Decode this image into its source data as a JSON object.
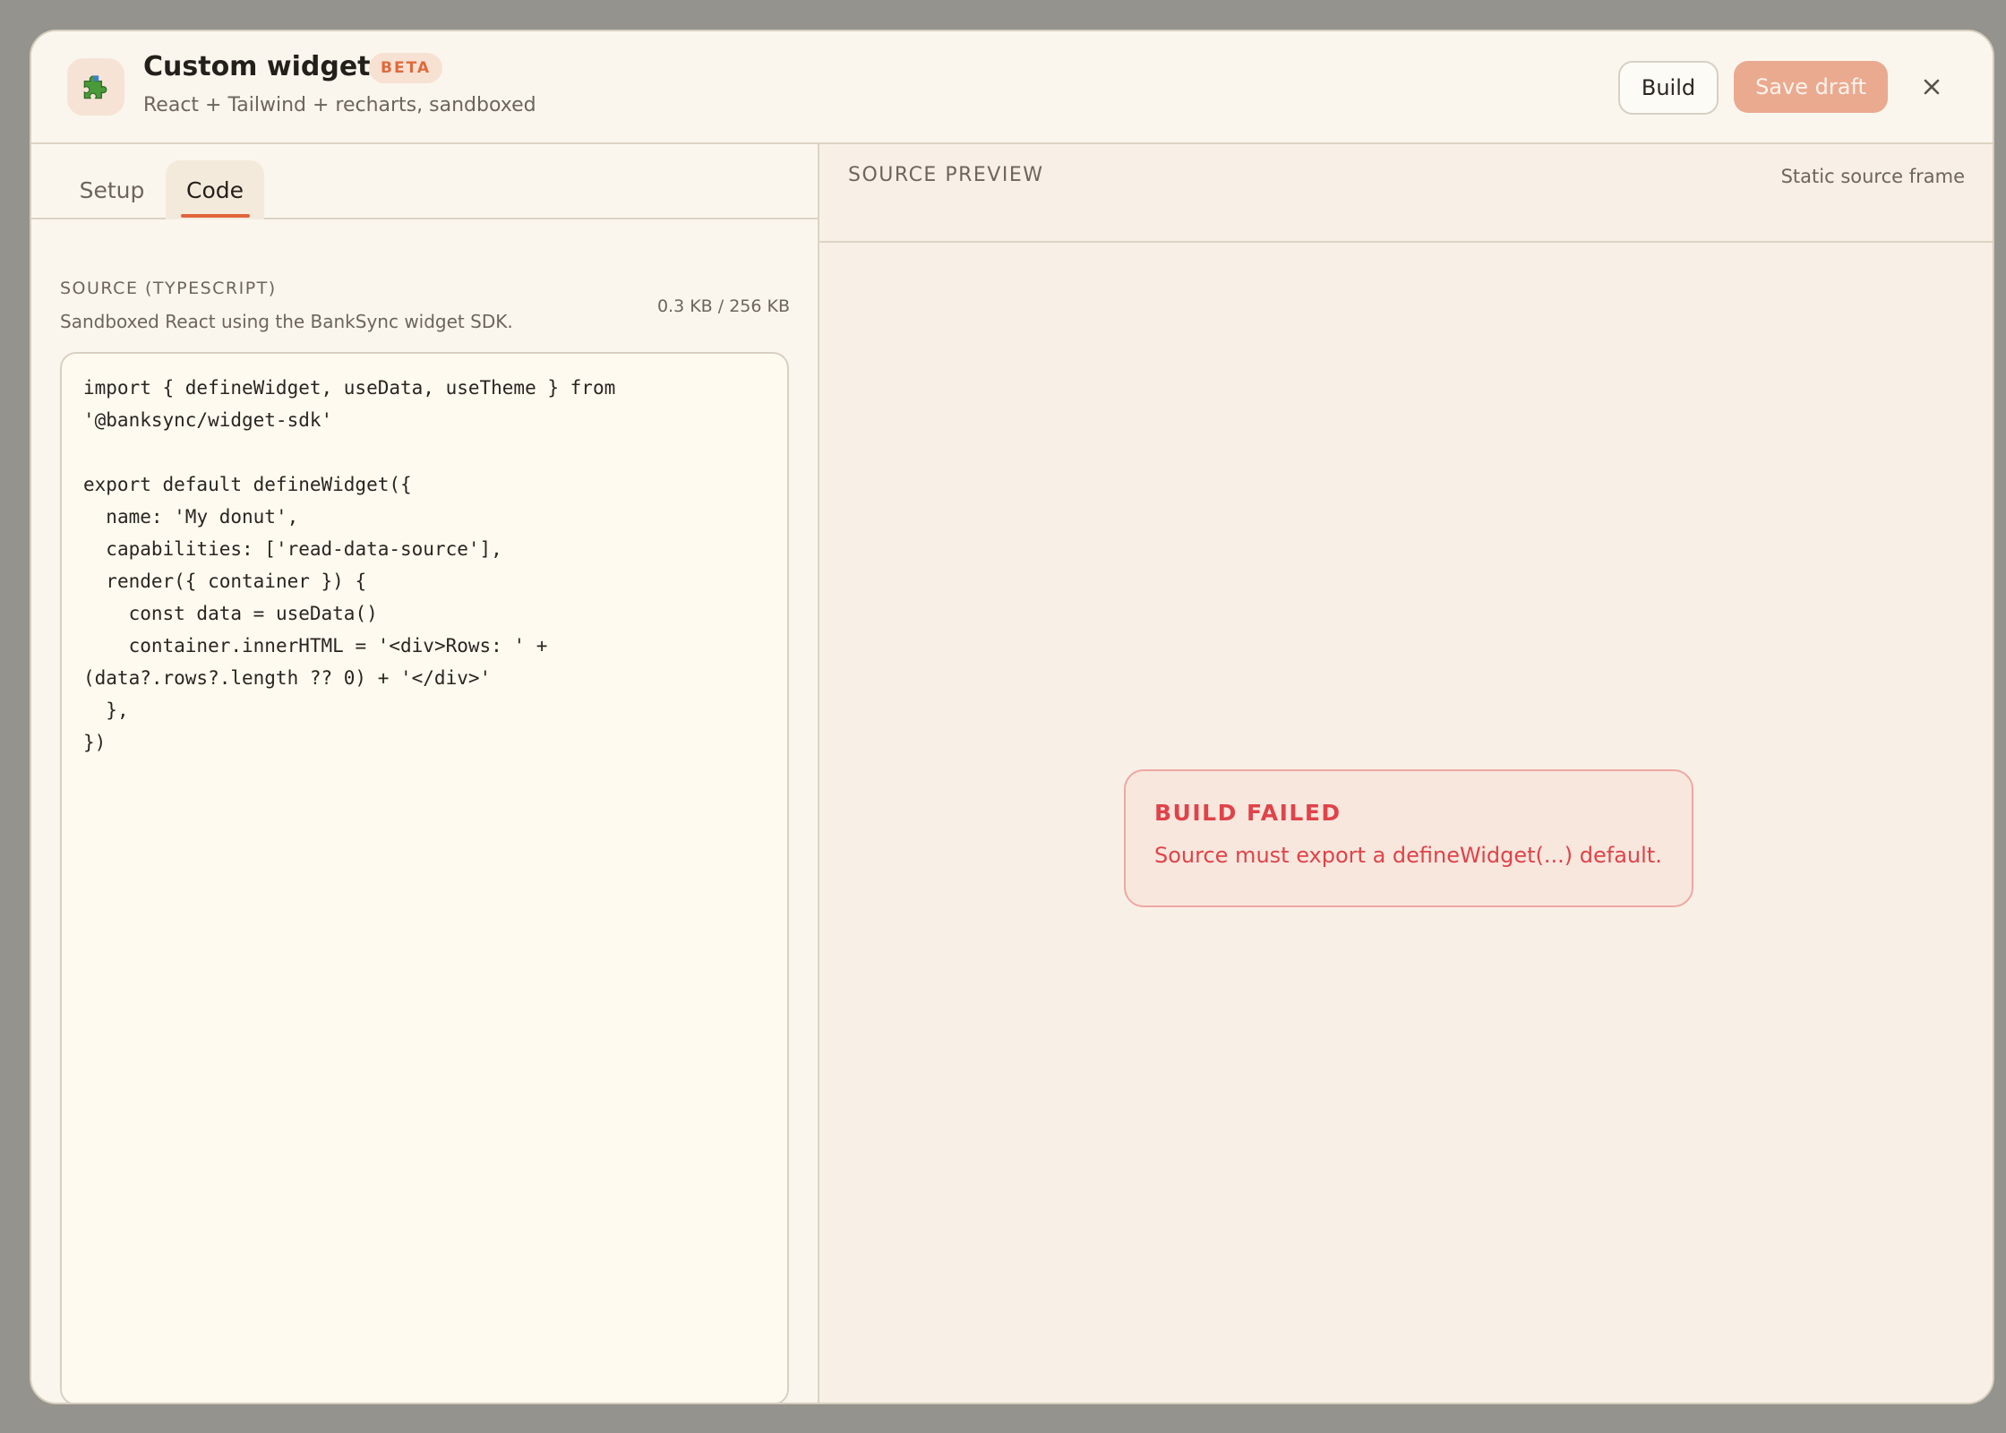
{
  "header": {
    "app_icon": "puzzle-piece-icon",
    "title": "Custom widget",
    "badge": "BETA",
    "subtitle": "React + Tailwind + recharts, sandboxed",
    "build_label": "Build",
    "save_label": "Save draft",
    "close_icon": "close-icon"
  },
  "tabs": [
    {
      "label": "Setup",
      "active": false
    },
    {
      "label": "Code",
      "active": true
    }
  ],
  "source": {
    "label": "SOURCE (TYPESCRIPT)",
    "description": "Sandboxed React using the BankSync widget SDK.",
    "size": "0.3 KB / 256 KB",
    "code": "import { defineWidget, useData, useTheme } from '@banksync/widget-sdk'\n\nexport default defineWidget({\n  name: 'My donut',\n  capabilities: ['read-data-source'],\n  render({ container }) {\n    const data = useData()\n    container.innerHTML = '<div>Rows: ' + (data?.rows?.length ?? 0) + '</div>'\n  },\n})"
  },
  "preview": {
    "label": "SOURCE PREVIEW",
    "frame_label": "Static source frame",
    "error_title": "BUILD FAILED",
    "error_message": "Source must export a defineWidget(...) default."
  },
  "colors": {
    "accent": "#e0643a",
    "badge_text": "#de6a3c",
    "save_button": "#eaaa90",
    "error": "#e0434a",
    "error_border": "#eea7a5",
    "modal_bg": "#faf5ec",
    "backdrop": "#94938e"
  }
}
